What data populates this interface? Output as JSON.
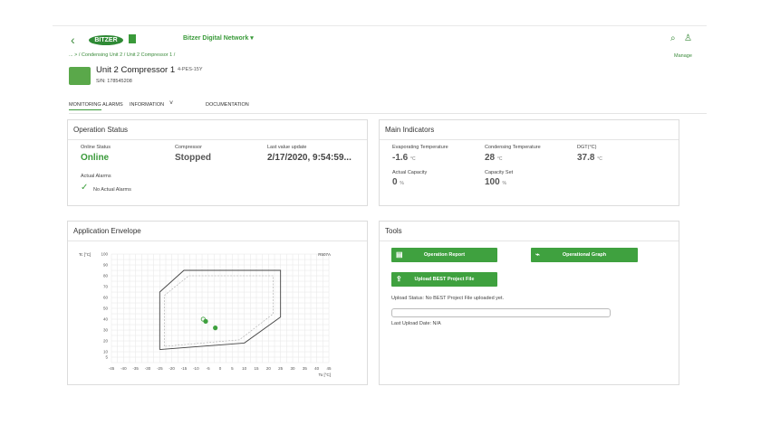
{
  "header": {
    "back_icon": "chevron-left-icon",
    "logo_text": "BITZER",
    "network_label": "Bitzer Digital Network ▾",
    "search_icon": "search-icon",
    "user_icon": "user-icon",
    "breadcrumb": "... > / Condensing Unit 2 / Unit 2 Compressor 1 /",
    "manage_label": "Manage"
  },
  "unit": {
    "title": "Unit 2 Compressor 1",
    "model": "4-PES-15Y",
    "serial": "S/N: 178545208"
  },
  "tabs": [
    {
      "label": "MONITORING"
    },
    {
      "label": "ALARMS"
    },
    {
      "label": "INFORMATION"
    },
    {
      "label": "DOCUMENTATION"
    }
  ],
  "operation_status": {
    "title": "Operation Status",
    "online_label": "Online Status",
    "online_value": "Online",
    "compressor_label": "Compressor",
    "compressor_value": "Stopped",
    "last_update_label": "Last value update",
    "last_update_value": "2/17/2020, 9:54:59...",
    "alarms_label": "Actual Alarms",
    "alarms_value": "No Actual Alarms"
  },
  "main_indicators": {
    "title": "Main Indicators",
    "items": [
      {
        "label": "Evaporating Temperature",
        "value": "-1.6",
        "unit": "°C"
      },
      {
        "label": "Condensing Temperature",
        "value": "28",
        "unit": "°C"
      },
      {
        "label": "DGT(°C)",
        "value": "37.8",
        "unit": "°C"
      },
      {
        "label": "Actual Capacity",
        "value": "0",
        "unit": "%"
      },
      {
        "label": "Capacity Set",
        "value": "100",
        "unit": "%"
      }
    ]
  },
  "envelope": {
    "title": "Application Envelope",
    "refrigerant": "R507A",
    "ylabel": "Tc [°C]",
    "xlabel": "To [°C]"
  },
  "chart_data": {
    "type": "scatter",
    "title": "Application Envelope",
    "xlabel": "To [°C]",
    "ylabel": "Tc [°C]",
    "legend": "R507A",
    "xlim": [
      -45,
      45
    ],
    "ylim": [
      0,
      100
    ],
    "xticks": [
      -45,
      -40,
      -35,
      -30,
      -25,
      -20,
      -15,
      -10,
      -5,
      0,
      5,
      10,
      15,
      20,
      25,
      30,
      35,
      40,
      45
    ],
    "yticks": [
      5,
      10,
      20,
      30,
      40,
      50,
      60,
      70,
      80,
      90,
      100
    ],
    "envelope_outer": [
      [
        -25,
        12
      ],
      [
        -25,
        65
      ],
      [
        -15,
        85
      ],
      [
        25,
        85
      ],
      [
        25,
        42
      ],
      [
        10,
        18
      ],
      [
        -25,
        12
      ]
    ],
    "envelope_inner": [
      [
        -23,
        15
      ],
      [
        -23,
        62
      ],
      [
        -13,
        80
      ],
      [
        22,
        80
      ],
      [
        22,
        45
      ],
      [
        8,
        21
      ],
      [
        -23,
        15
      ]
    ],
    "points": [
      [
        -7,
        40
      ],
      [
        -6,
        38
      ],
      [
        -2,
        32
      ]
    ]
  },
  "tools": {
    "title": "Tools",
    "buttons": [
      {
        "label": "Operation Report",
        "icon": "report-icon"
      },
      {
        "label": "Operational Graph",
        "icon": "graph-icon"
      },
      {
        "label": "Upload BEST Project File",
        "icon": "upload-icon"
      }
    ],
    "upload_status": "Upload Status: No BEST Project File uploaded yet.",
    "last_upload": "Last Upload Date: N/A"
  },
  "colors": {
    "accent": "#3fa13f",
    "grid": "#e6e6e6"
  }
}
